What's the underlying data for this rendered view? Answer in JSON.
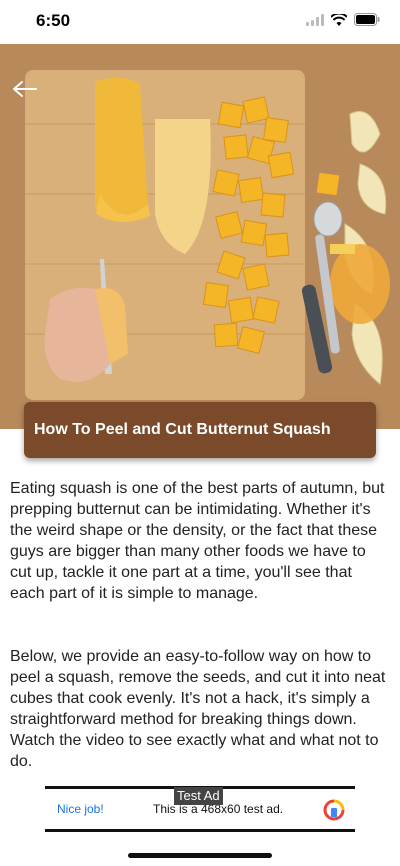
{
  "status_bar": {
    "time": "6:50"
  },
  "article": {
    "title": "How To Peel and Cut Butternut Squash",
    "paragraphs": [
      "Eating squash is one of the best parts of autumn, but prepping butternut can be intimidating. Whether it's the weird shape or the density, or the fact that these guys are bigger than many other foods we have to cut up, tackle it one part at a time, you'll see that each part of it is simple to manage.",
      "Below, we provide an easy-to-follow way on how to peel a squash, remove the seeds, and cut it into neat cubes that cook evenly. It's not a hack, it's simply a straightforward method for breaking things down. Watch the video to see exactly what and what not to do."
    ]
  },
  "ad": {
    "label": "Test Ad",
    "cta": "Nice job!",
    "text": "This is a 468x60 test ad."
  },
  "icons": {
    "back": "back-arrow-icon",
    "signal": "signal-icon",
    "wifi": "wifi-icon",
    "battery": "battery-icon",
    "ad_logo": "ad-logo-icon"
  },
  "colors": {
    "banner": "#7a4a2a",
    "ad_cta": "#1a73e8"
  }
}
